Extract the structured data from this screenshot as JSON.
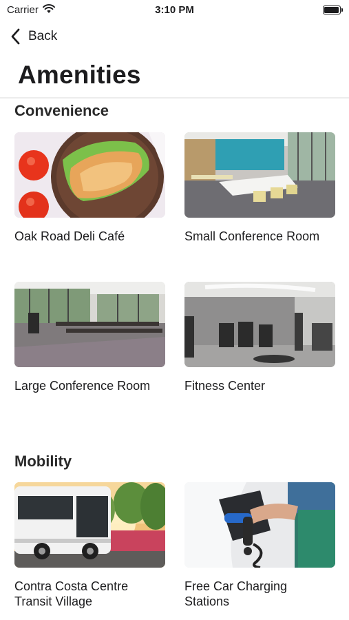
{
  "status_bar": {
    "carrier": "Carrier",
    "time": "3:10 PM"
  },
  "nav": {
    "back_label": "Back"
  },
  "page": {
    "title": "Amenities"
  },
  "sections": [
    {
      "title": "Convenience",
      "items": [
        {
          "label": "Oak Road Deli Café"
        },
        {
          "label": "Small Conference Room"
        },
        {
          "label": "Large Conference Room"
        },
        {
          "label": "Fitness Center"
        }
      ]
    },
    {
      "title": "Mobility",
      "items": [
        {
          "label": "Contra Costa Centre Transit Village"
        },
        {
          "label": "Free Car Charging Stations"
        }
      ]
    }
  ]
}
